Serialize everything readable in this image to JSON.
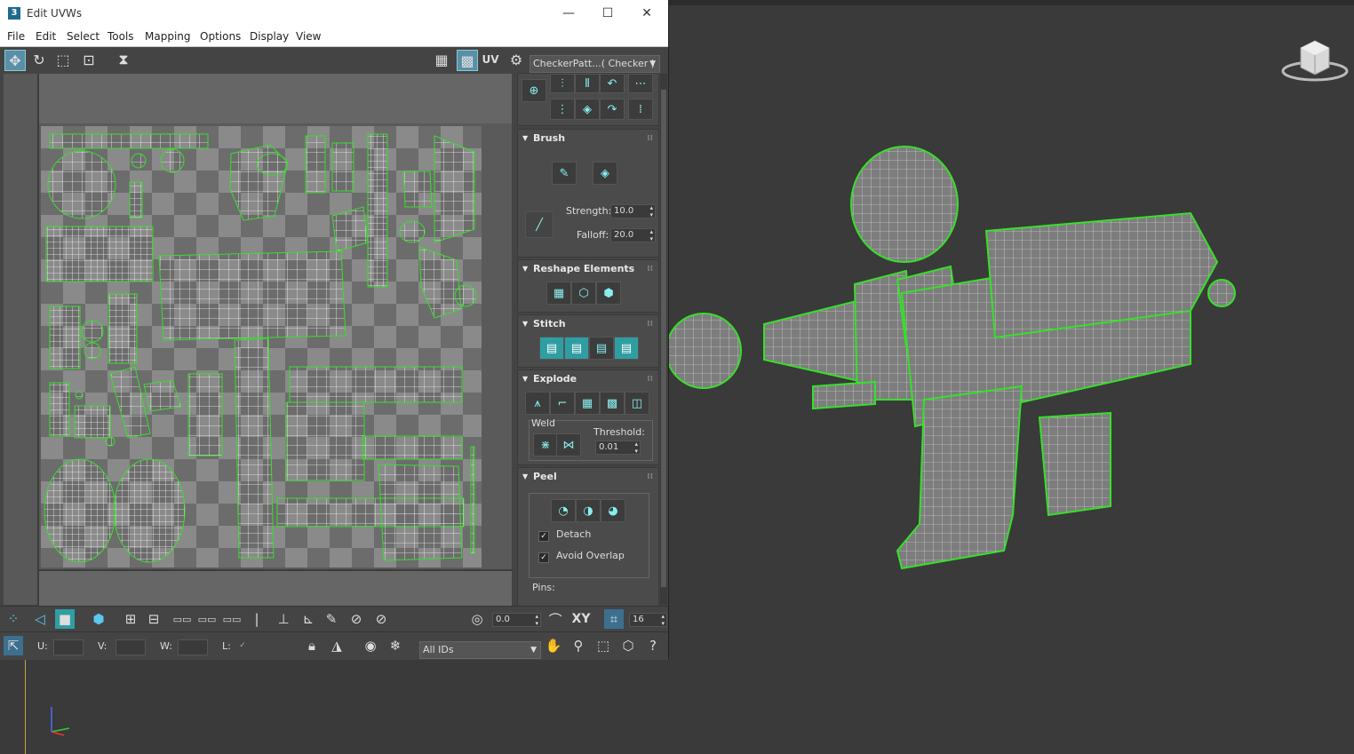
{
  "window": {
    "title": "Edit UVWs",
    "app_icon": "3",
    "minimize": "—",
    "maximize": "☐",
    "close": "✕"
  },
  "menu": [
    "File",
    "Edit",
    "Select",
    "Tools",
    "Mapping",
    "Options",
    "Display",
    "View"
  ],
  "toolbar": {
    "uv_label": "UV",
    "texture_dropdown": "CheckerPatt...( Checker )"
  },
  "brush": {
    "title": "Brush",
    "strength_label": "Strength:",
    "strength_value": "10.0",
    "falloff_label": "Falloff:",
    "falloff_value": "20.0"
  },
  "reshape": {
    "title": "Reshape Elements"
  },
  "stitch": {
    "title": "Stitch"
  },
  "explode": {
    "title": "Explode",
    "weld_label": "Weld",
    "threshold_label": "Threshold:",
    "threshold_value": "0.01"
  },
  "peel": {
    "title": "Peel",
    "detach_label": "Detach",
    "detach_checked": true,
    "avoid_overlap_label": "Avoid Overlap",
    "avoid_overlap_checked": true,
    "pins_label": "Pins:"
  },
  "bottom1": {
    "soft_value": "0.0",
    "xy_label": "XY",
    "grid_value": "16"
  },
  "bottom2": {
    "u_label": "U:",
    "v_label": "V:",
    "w_label": "W:",
    "l_label": "L:",
    "ids_dropdown": "All IDs"
  },
  "colors": {
    "accent_teal": "#2f9ea3",
    "wire_green": "#37e02a",
    "viewport_bg": "#3a3a3a"
  }
}
